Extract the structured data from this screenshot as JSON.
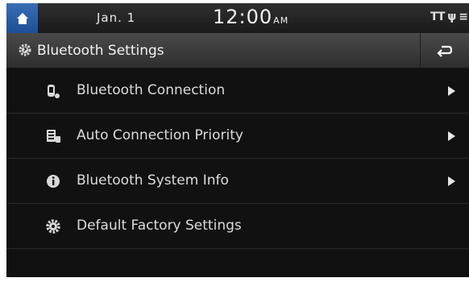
{
  "status": {
    "date": "Jan.  1",
    "time": "12:00",
    "ampm": "AM",
    "indicators": "TT ψ ≡"
  },
  "title": {
    "text": "Bluetooth Settings",
    "icon": "bluetooth-gear-icon",
    "back_icon": "back-arrow-icon"
  },
  "menu": {
    "items": [
      {
        "label": "Bluetooth Connection",
        "icon": "phone-bluetooth-icon",
        "has_arrow": true
      },
      {
        "label": "Auto Connection Priority",
        "icon": "priority-list-icon",
        "has_arrow": true
      },
      {
        "label": "Bluetooth System Info",
        "icon": "info-icon",
        "has_arrow": true
      },
      {
        "label": "Default Factory Settings",
        "icon": "gear-icon",
        "has_arrow": false
      }
    ]
  },
  "colors": {
    "home_button": "#2a5fa6",
    "background": "#111111",
    "title_bar": "#3a3a3a",
    "text": "#dcdcdc"
  }
}
